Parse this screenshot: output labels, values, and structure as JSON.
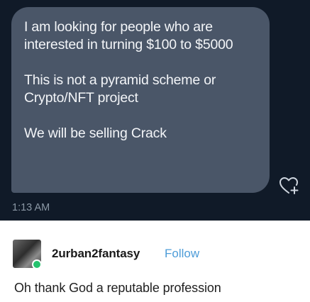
{
  "message": {
    "paragraphs": [
      "I am looking for people who are interested in turning $100 to $5000",
      "This is not a pyramid scheme or Crypto/NFT project",
      "We will be selling Crack"
    ],
    "timestamp": "1:13 AM",
    "react_icon": "heart-plus-icon"
  },
  "post": {
    "username": "2urban2fantasy",
    "follow_label": "Follow",
    "text": "Oh thank God a reputable profession",
    "avatar_icon": "avatar-image"
  },
  "colors": {
    "dm_background": "#101a28",
    "bubble": "#4a5668",
    "follow_link": "#4d9cd8",
    "online_badge": "#25c26e"
  }
}
